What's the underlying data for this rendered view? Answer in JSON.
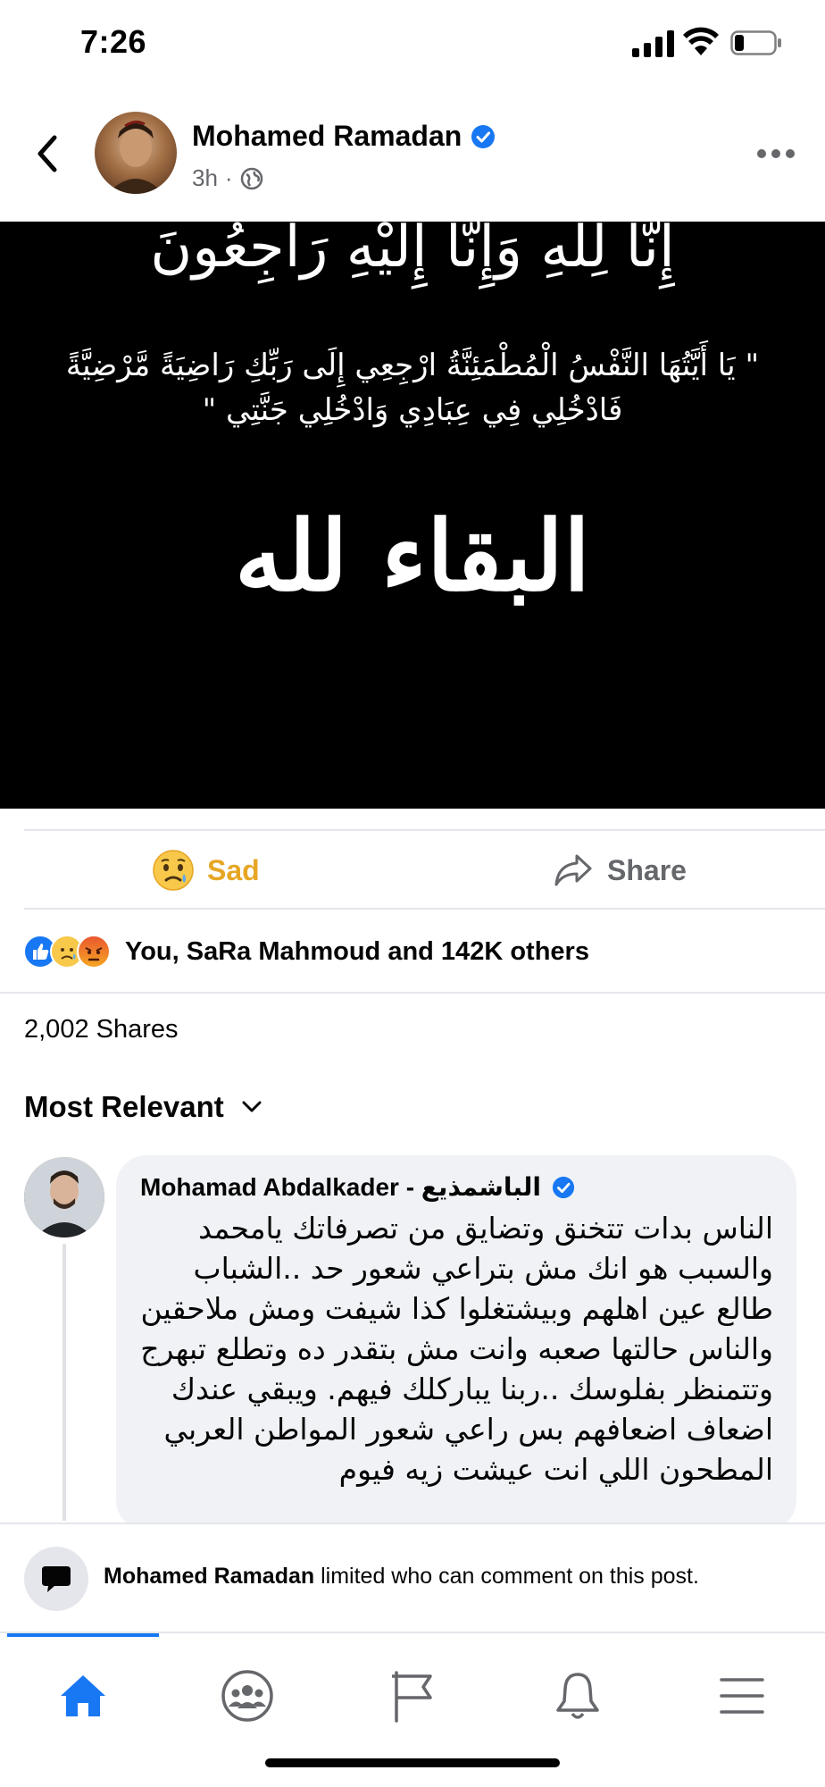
{
  "status_bar": {
    "time": "7:26"
  },
  "post": {
    "author": "Mohamed Ramadan",
    "time_ago": "3h",
    "separator": "·",
    "privacy_icon": "globe-icon",
    "image_text": {
      "line1": "إِنَّا لِلَّهِ وَإِنَّا إِلَيْهِ رَاجِعُونَ",
      "line2": "\" يَا أَيَّتُهَا النَّفْسُ الْمُطْمَئِنَّةُ ارْجِعِي إِلَى رَبِّكِ رَاضِيَةً مَّرْضِيَّةً",
      "line3": "فَادْخُلِي فِي عِبَادِي وَادْخُلِي جَنَّتِي \"",
      "line4": "البقاء لله"
    }
  },
  "actions": {
    "sad_label": "Sad",
    "share_label": "Share"
  },
  "reactions": {
    "summary": "You, SaRa Mahmoud and 142K others",
    "icons": [
      "like-icon",
      "sad-icon",
      "angry-icon"
    ]
  },
  "shares": {
    "text": "2,002 Shares"
  },
  "sort": {
    "label": "Most Relevant"
  },
  "comment": {
    "author": "Mohamad Abdalkader - الباشمذيع",
    "text": "الناس بدات تتخنق وتضايق من تصرفاتك يامحمد والسبب هو انك مش بتراعي شعور حد ..الشباب طالع عين اهلهم وبيشتغلوا كذا شيفت ومش ملاحقين والناس حالتها صعبه وانت مش بتقدر ده وتطلع تبهرج وتتمنظر بفلوسك ..ربنا يباركلك فيهم. ويبقي عندك اضعاف اضعافهم بس راعي شعور المواطن العربي المطحون اللي انت عيشت زيه فيوم"
  },
  "limited_notice": {
    "name": "Mohamed Ramadan",
    "text": " limited who can comment on this post."
  },
  "bottom_nav": {
    "items": [
      "home-icon",
      "groups-icon",
      "pages-icon",
      "notifications-icon",
      "menu-icon"
    ],
    "active": "home-icon"
  },
  "colors": {
    "facebook_blue": "#1877f2",
    "sad_yellow": "#e7a624",
    "secondary_text": "#65676b",
    "bubble_bg": "#f0f2f5"
  }
}
